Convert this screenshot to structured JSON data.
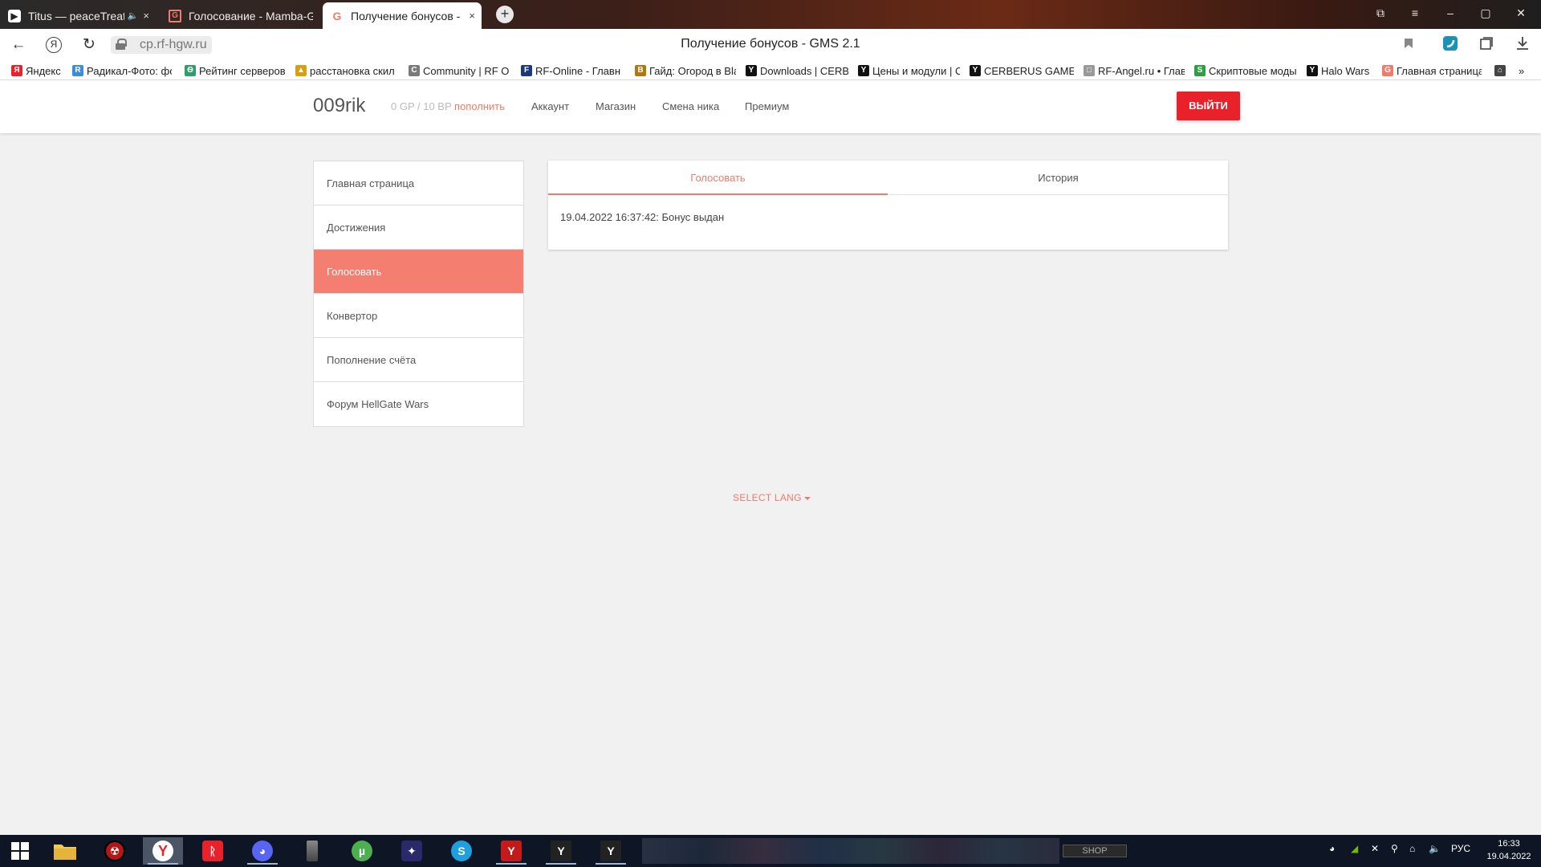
{
  "browser": {
    "tabs": [
      {
        "title": "Titus — peaceTreaty,",
        "icon": "play-icon",
        "audio": "🔈",
        "close": "×"
      },
      {
        "title": "Голосование - Mamba-Ga",
        "icon": "g-icon",
        "close": "×"
      },
      {
        "title": "Получение бонусов - C",
        "icon": "g-icon",
        "close": "×"
      }
    ],
    "new_tab": "+",
    "window_controls": [
      "⧉",
      "≡",
      "–",
      "▢",
      "✕"
    ],
    "nav": {
      "back": "←",
      "yandex": "Я",
      "reload": "↻"
    },
    "url": "cp.rf-hgw.ru",
    "page_title": "Получение бонусов - GMS 2.1",
    "right_icons": [
      "bookmark-icon",
      "extension-icon",
      "collections-icon",
      "download-icon"
    ],
    "bookmarks": [
      {
        "label": "Яндекс",
        "color": "#e8212b",
        "glyph": "Я"
      },
      {
        "label": "Радикал-Фото: фо",
        "color": "#3b8ed8",
        "glyph": "R"
      },
      {
        "label": "Рейтинг серверов",
        "color": "#2e9e6a",
        "glyph": "Ѳ"
      },
      {
        "label": "расстановка скил",
        "color": "#d8a010",
        "glyph": "▲"
      },
      {
        "label": "Community | RF O",
        "color": "#7a7a7a",
        "glyph": "C"
      },
      {
        "label": "RF-Online - Главн",
        "color": "#1a3a7a",
        "glyph": "F"
      },
      {
        "label": "Гайд: Огород в Bla",
        "color": "#b07810",
        "glyph": "B"
      },
      {
        "label": "Downloads | CERBE",
        "color": "#111111",
        "glyph": "Y"
      },
      {
        "label": "Цены и модули | C",
        "color": "#111111",
        "glyph": "Y"
      },
      {
        "label": "CERBERUS GAMES",
        "color": "#111111",
        "glyph": "Y"
      },
      {
        "label": "RF-Angel.ru • Глав",
        "color": "#999999",
        "glyph": "□"
      },
      {
        "label": "Скриптовые моды",
        "color": "#2ea043",
        "glyph": "S"
      },
      {
        "label": "Halo Wars",
        "color": "#111111",
        "glyph": "Y"
      },
      {
        "label": "Главная страница",
        "color": "#f07b6b",
        "glyph": "G"
      },
      {
        "label": "",
        "color": "#444444",
        "glyph": "⌂"
      }
    ],
    "bookmarks_more": "»"
  },
  "header": {
    "username": "009rik",
    "balance": "0 GP / 10 BP",
    "topup": "пополнить",
    "nav": [
      "Аккаунт",
      "Магазин",
      "Смена ника",
      "Премиум"
    ],
    "logout": "ВЫЙТИ"
  },
  "sidebar": {
    "items": [
      "Главная страница",
      "Достижения",
      "Голосовать",
      "Конвертор",
      "Пополнение счёта",
      "Форум HellGate Wars"
    ],
    "active_index": 2
  },
  "panel": {
    "tabs": [
      "Голосовать",
      "История"
    ],
    "active_tab": 0,
    "entry": "19.04.2022 16:37:42: Бонус выдан"
  },
  "footer": {
    "lang": "SELECT LANG"
  },
  "taskbar": {
    "shop": "SHOP",
    "lang": "РУС",
    "time": "16:33",
    "date": "19.04.2022"
  },
  "colors": {
    "accent": "#f07b6b",
    "active_side": "#f47f71",
    "logout": "#e8212b"
  }
}
